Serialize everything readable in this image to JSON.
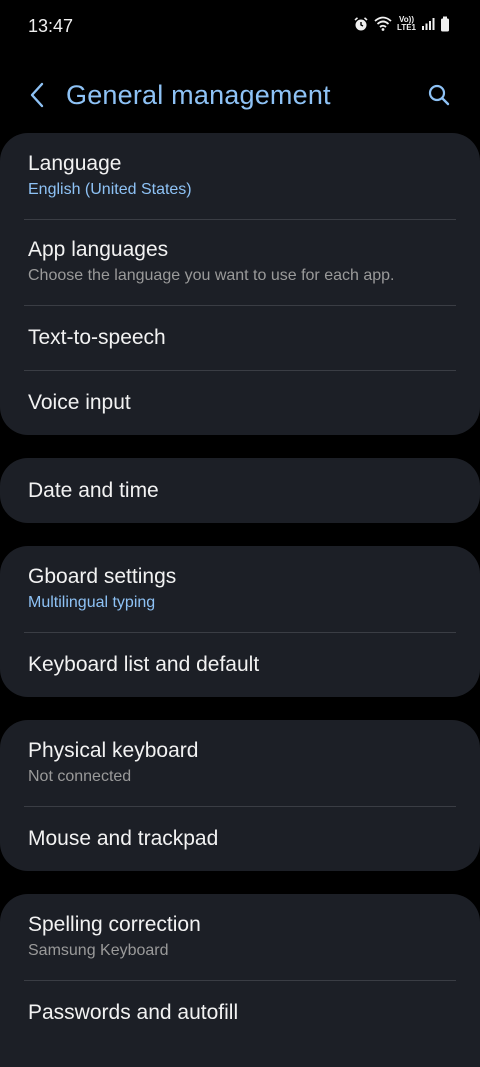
{
  "status": {
    "time": "13:47",
    "lte_top": "Vo))",
    "lte_bottom": "LTE1"
  },
  "header": {
    "title": "General management"
  },
  "colors": {
    "accent": "#8ec2f5",
    "card_bg": "#1c1f26",
    "background": "#000000"
  },
  "groups": [
    {
      "items": [
        {
          "title": "Language",
          "subtitle": "English (United States)"
        },
        {
          "title": "App languages",
          "subtitle": "Choose the language you want to use for each app."
        },
        {
          "title": "Text-to-speech"
        },
        {
          "title": "Voice input"
        }
      ]
    },
    {
      "items": [
        {
          "title": "Date and time"
        }
      ]
    },
    {
      "items": [
        {
          "title": "Gboard settings",
          "subtitle": "Multilingual typing"
        },
        {
          "title": "Keyboard list and default"
        }
      ]
    },
    {
      "items": [
        {
          "title": "Physical keyboard",
          "subtitle": "Not connected"
        },
        {
          "title": "Mouse and trackpad"
        }
      ]
    },
    {
      "items": [
        {
          "title": "Spelling correction",
          "subtitle": "Samsung Keyboard"
        },
        {
          "title": "Passwords and autofill"
        }
      ]
    }
  ]
}
